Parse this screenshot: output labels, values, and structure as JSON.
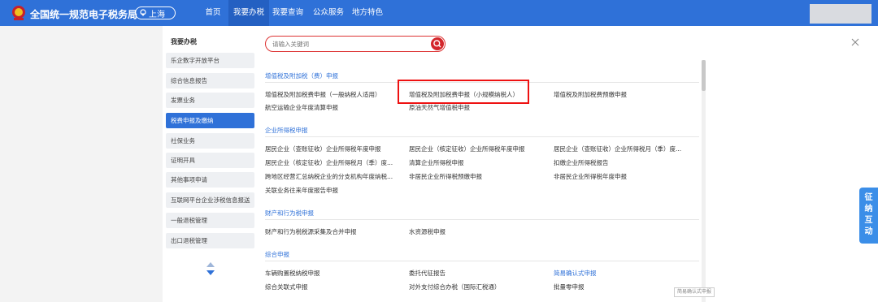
{
  "header": {
    "site_title": "全国统一规范电子税务局",
    "city": "上海",
    "nav": [
      "首页",
      "我要办税",
      "我要查询",
      "公众服务",
      "地方特色"
    ],
    "active_nav": "我要办税"
  },
  "sidebar": {
    "title": "我要办税",
    "items": [
      "乐企数字开放平台",
      "综合信息报告",
      "发票业务",
      "税费申报及缴纳",
      "社保业务",
      "证明开具",
      "其他事项申请",
      "互联网平台企业涉税信息报送",
      "一般退税管理",
      "出口退税管理"
    ],
    "active_item": "税费申报及缴纳"
  },
  "search": {
    "placeholder": "请输入关键词"
  },
  "sections": [
    {
      "title": "增值税及附加税（费）申报",
      "links": [
        "增值税及附加税费申报（一般纳税人适用）",
        "增值税及附加税费申报（小规模纳税人）",
        "增值税及附加税费预缴申报",
        "航空运输企业年度清算申报",
        "原油天然气增值税申报"
      ]
    },
    {
      "title": "企业所得税申报",
      "links": [
        "居民企业（查账征收）企业所得税年度申报",
        "居民企业（核定征收）企业所得税年度申报",
        "居民企业（查账征收）企业所得税月（季）度...",
        "居民企业（核定征收）企业所得税月（季）度...",
        "清算企业所得税申报",
        "扣缴企业所得税报告",
        "跨地区经营汇总纳税企业的分支机构年度纳税...",
        "非居民企业所得税预缴申报",
        "非居民企业所得税年度申报",
        "关联业务往来年度报告申报"
      ]
    },
    {
      "title": "财产和行为税申报",
      "links": [
        "财产和行为税税源采集及合并申报",
        "水资源税申报"
      ]
    },
    {
      "title": "综合申报",
      "links": [
        "车辆购置税纳税申报",
        "委托代征报告",
        "简易确认式申报",
        "综合关联式申报",
        "对外支付综合办税（国际汇税通）",
        "批量零申报"
      ]
    }
  ],
  "tooltip": "简易确认式申报",
  "float_tab": [
    "征",
    "纳",
    "互",
    "动"
  ],
  "colors": {
    "header_blue": "#2f71d8",
    "highlight_red": "#e11111",
    "link_blue": "#2f71d8"
  }
}
